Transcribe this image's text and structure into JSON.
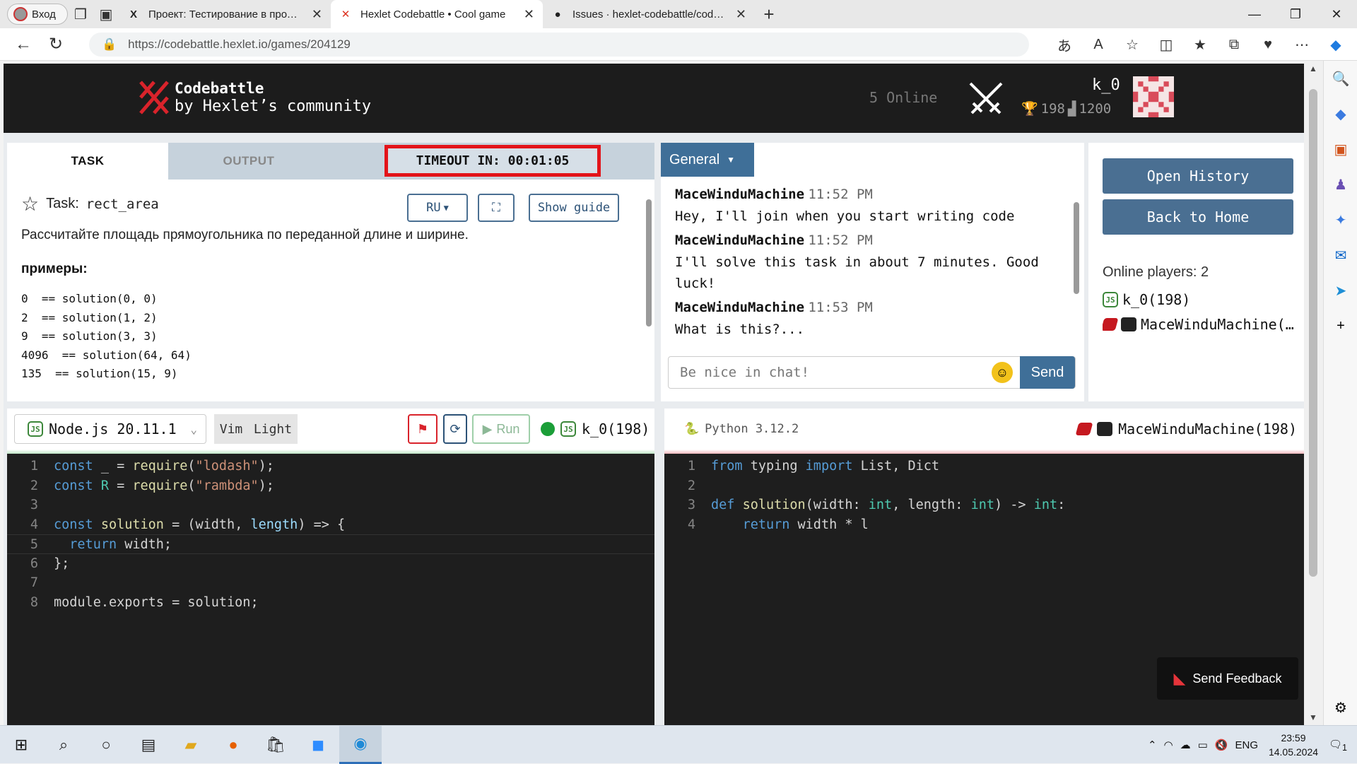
{
  "browser": {
    "profile_label": "Вход",
    "tabs": [
      {
        "title": "Проект: Тестирование в продакшене",
        "favicon": "x"
      },
      {
        "title": "Hexlet Codebattle • Cool game",
        "favicon": "codebattle"
      },
      {
        "title": "Issues · hexlet-codebattle/codebattle",
        "favicon": "github"
      }
    ],
    "url": "https://codebattle.hexlet.io/games/204129"
  },
  "header": {
    "brand_line1": "Codebattle",
    "brand_line2": "by Hexlet’s community",
    "online": "5 Online",
    "username": "k_0",
    "rating_cup": "198",
    "rating": "1200"
  },
  "task": {
    "tab_task": "TASK",
    "tab_output": "OUTPUT",
    "timeout": "TIMEOUT IN: 00:01:05",
    "task_label": "Task:",
    "task_name": "rect_area",
    "lang_btn": "RU",
    "guide_btn": "Show guide",
    "description": "Рассчитайте площадь прямоугольника по переданной длине и ширине.",
    "examples_heading": "примеры:",
    "examples": "0  == solution(0, 0)\n2  == solution(1, 2)\n9  == solution(3, 3)\n4096  == solution(64, 64)\n135  == solution(15, 9)"
  },
  "chat": {
    "channel": "General",
    "messages": [
      {
        "author": "MaceWinduMachine",
        "time": "11:52 PM",
        "text": "Hey, I'll join when you start writing code"
      },
      {
        "author": "MaceWinduMachine",
        "time": "11:52 PM",
        "text": "I'll solve this task in about 7 minutes. Good luck!"
      },
      {
        "author": "MaceWinduMachine",
        "time": "11:53 PM",
        "text": "What is this?..."
      }
    ],
    "placeholder": "Be nice in chat!",
    "send": "Send"
  },
  "side": {
    "open_history": "Open History",
    "back_home": "Back to Home",
    "online_players": "Online players: 2",
    "players": [
      "k_0(198)",
      "MaceWinduMachine(198)"
    ]
  },
  "left_editor": {
    "language": "Node.js 20.11.1",
    "vim": "Vim",
    "light": "Light",
    "run": "Run",
    "player": "k_0(198)",
    "lines": [
      "1",
      "2",
      "3",
      "4",
      "5",
      "6",
      "7",
      "8"
    ]
  },
  "right_editor": {
    "language": "Python 3.12.2",
    "player": "MaceWinduMachine(198)",
    "lines": [
      "1",
      "2",
      "3",
      "4"
    ]
  },
  "feedback": "Send Feedback",
  "taskbar": {
    "lang": "ENG",
    "time": "23:59",
    "date": "14.05.2024",
    "notif": "1"
  },
  "colors": {
    "accent": "#4a6f92",
    "header_bg": "#1c1c1c",
    "timeout_border": "#e3141a",
    "editor_bg": "#1e1e1e",
    "green": "#1b9e38"
  }
}
